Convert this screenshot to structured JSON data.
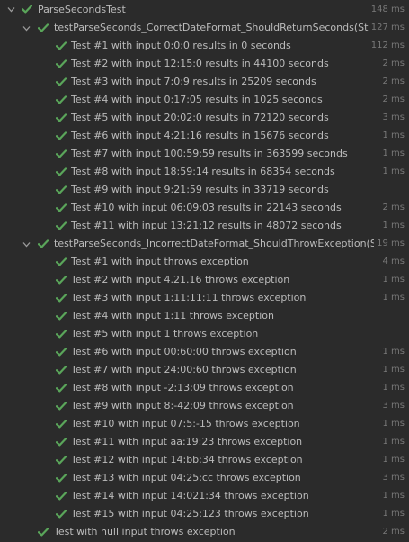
{
  "colors": {
    "background": "#2b2b2b",
    "pass_green": "#5aa55a",
    "text": "#bbbbbb",
    "time": "#787878"
  },
  "icons": {
    "expand": "chevron-down-icon",
    "status": "check-icon"
  },
  "root": {
    "label": "ParseSecondsTest",
    "time": "148 ms",
    "groups": [
      {
        "label": "testParseSeconds_CorrectDateFormat_ShouldReturnSeconds(String,",
        "time": "127 ms",
        "tests": [
          {
            "label": "Test #1 with input 0:0:0 results in 0 seconds",
            "time": "112 ms"
          },
          {
            "label": "Test #2 with input 12:15:0 results in 44100 seconds",
            "time": "2 ms"
          },
          {
            "label": "Test #3 with input 7:0:9 results in 25209 seconds",
            "time": "2 ms"
          },
          {
            "label": "Test #4 with input 0:17:05 results in 1025 seconds",
            "time": "2 ms"
          },
          {
            "label": "Test #5 with input 20:02:0 results in 72120 seconds",
            "time": "3 ms"
          },
          {
            "label": "Test #6 with input 4:21:16 results in 15676 seconds",
            "time": "1 ms"
          },
          {
            "label": "Test #7 with input 100:59:59 results in 363599 seconds",
            "time": "1 ms"
          },
          {
            "label": "Test #8 with input 18:59:14 results in 68354 seconds",
            "time": "1 ms"
          },
          {
            "label": "Test #9 with input 9:21:59 results in 33719 seconds",
            "time": ""
          },
          {
            "label": "Test #10 with input 06:09:03 results in 22143 seconds",
            "time": "2 ms"
          },
          {
            "label": "Test #11 with input 13:21:12 results in 48072 seconds",
            "time": "1 ms"
          }
        ]
      },
      {
        "label": "testParseSeconds_IncorrectDateFormat_ShouldThrowException(Strin",
        "time": "19 ms",
        "tests": [
          {
            "label": "Test #1 with input  throws exception",
            "time": "4 ms"
          },
          {
            "label": "Test #2 with input 4.21.16 throws exception",
            "time": "1 ms"
          },
          {
            "label": "Test #3 with input 1:11:11:11 throws exception",
            "time": "1 ms"
          },
          {
            "label": "Test #4 with input 1:11 throws exception",
            "time": ""
          },
          {
            "label": "Test #5 with input 1 throws exception",
            "time": ""
          },
          {
            "label": "Test #6 with input 00:60:00 throws exception",
            "time": "1 ms"
          },
          {
            "label": "Test #7 with input 24:00:60 throws exception",
            "time": "1 ms"
          },
          {
            "label": "Test #8 with input -2:13:09 throws exception",
            "time": "1 ms"
          },
          {
            "label": "Test #9 with input 8:-42:09 throws exception",
            "time": "3 ms"
          },
          {
            "label": "Test #10 with input 07:5:-15 throws exception",
            "time": "1 ms"
          },
          {
            "label": "Test #11 with input aa:19:23 throws exception",
            "time": "1 ms"
          },
          {
            "label": "Test #12 with input 14:bb:34 throws exception",
            "time": "1 ms"
          },
          {
            "label": "Test #13 with input 04:25:cc throws exception",
            "time": "3 ms"
          },
          {
            "label": "Test #14 with input 14:021:34 throws exception",
            "time": "1 ms"
          },
          {
            "label": "Test #15 with input 04:25:123 throws exception",
            "time": "1 ms"
          }
        ]
      }
    ],
    "extra": [
      {
        "label": "Test with null input throws exception",
        "time": "2 ms"
      }
    ]
  }
}
